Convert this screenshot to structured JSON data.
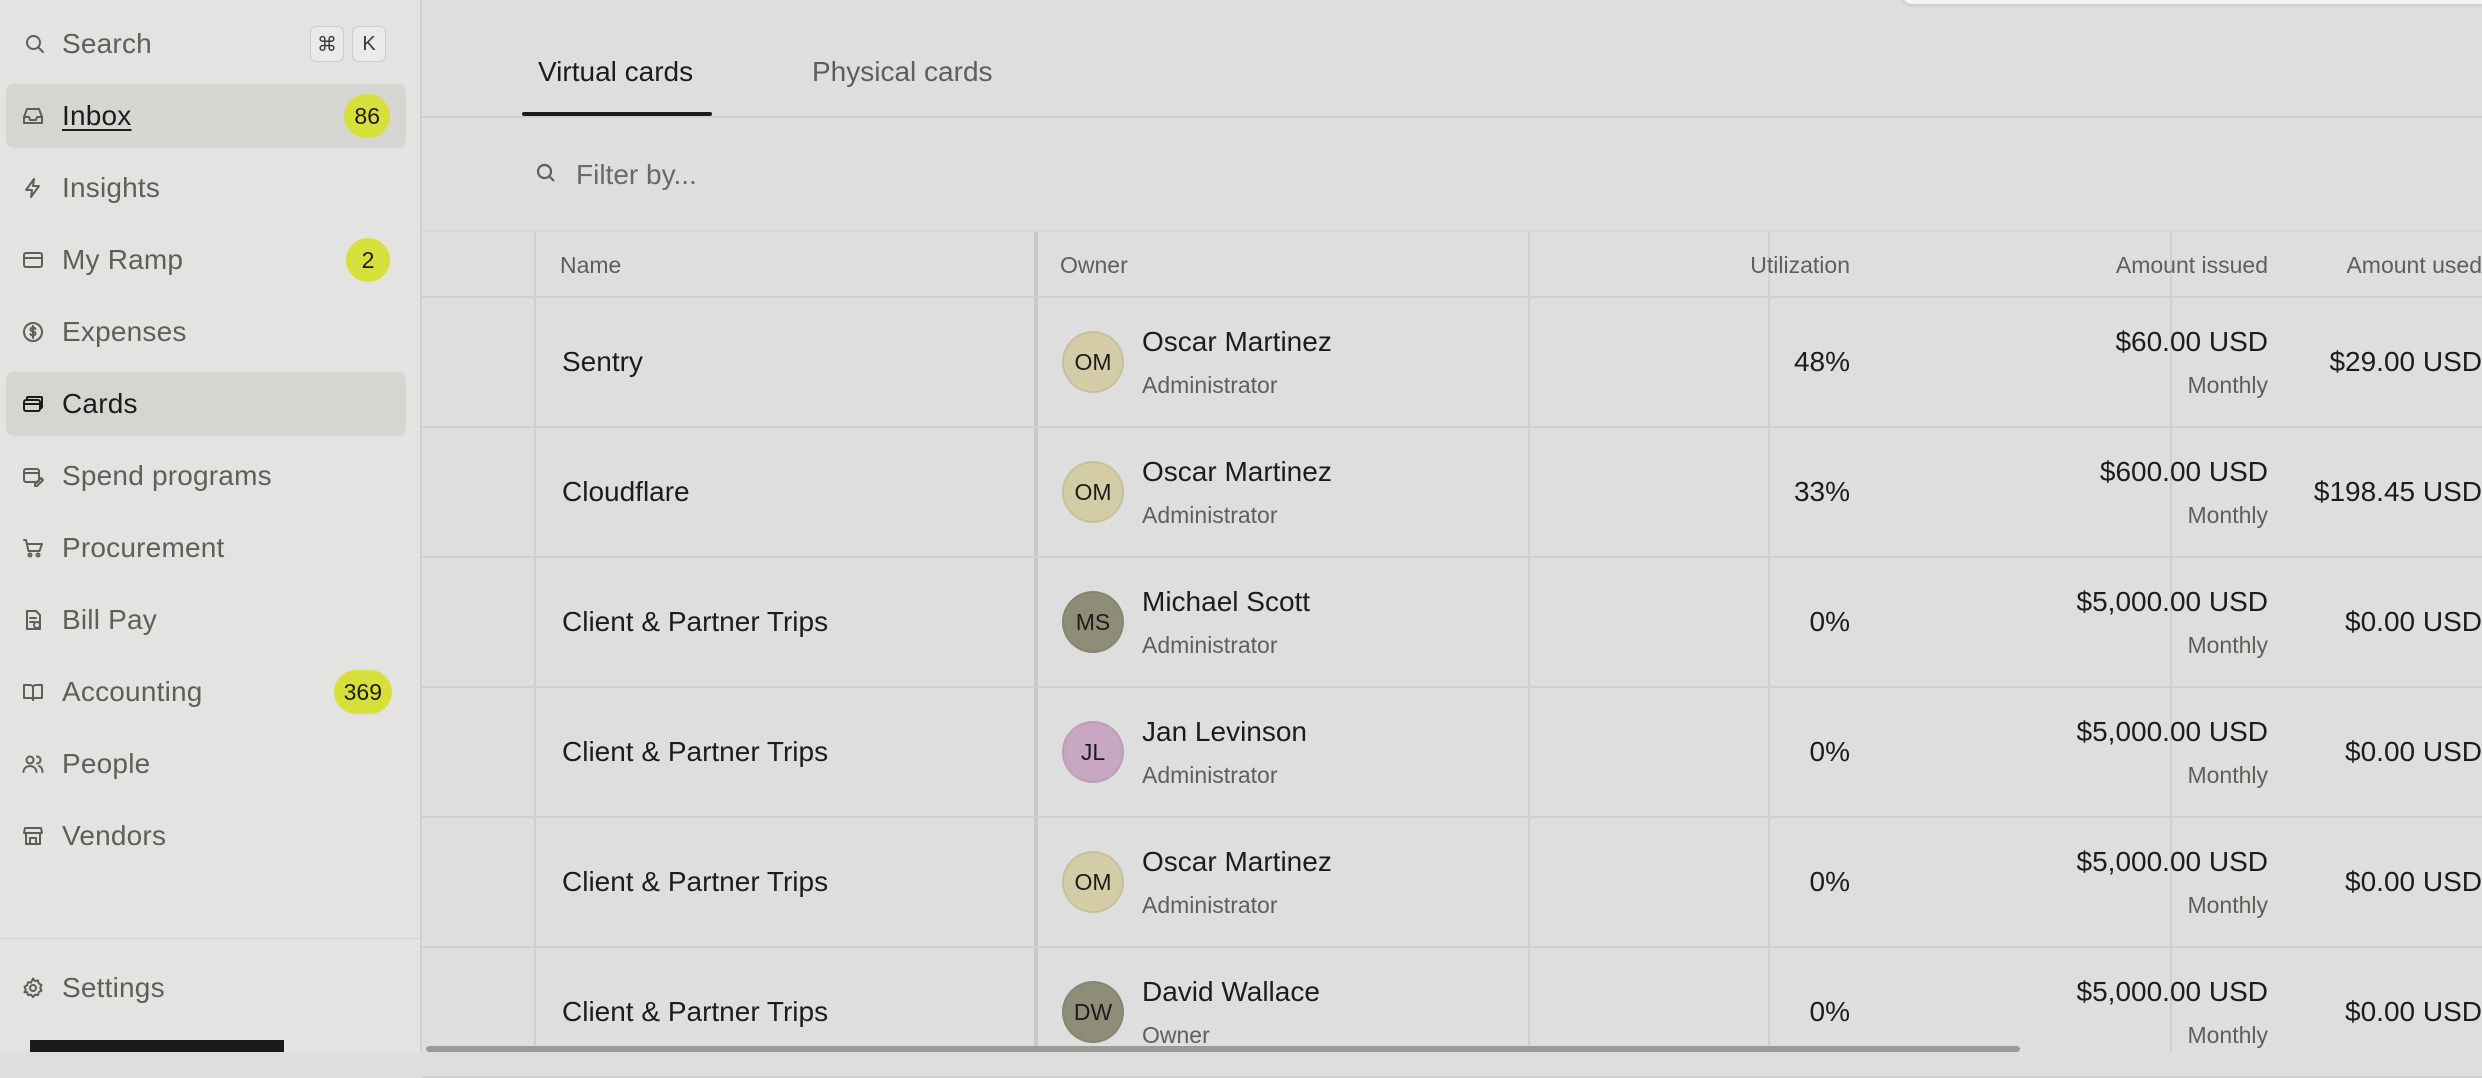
{
  "sidebar": {
    "search": {
      "label": "Search",
      "shortcut_keys": [
        "⌘",
        "K"
      ]
    },
    "items": [
      {
        "label": "Inbox",
        "icon": "inbox-icon",
        "badge": "86"
      },
      {
        "label": "Insights",
        "icon": "bolt-icon",
        "badge": null
      },
      {
        "label": "My Ramp",
        "icon": "card-outline-icon",
        "badge": "2"
      },
      {
        "label": "Expenses",
        "icon": "dollar-circle-icon",
        "badge": null
      },
      {
        "label": "Cards",
        "icon": "cards-stack-icon",
        "badge": null
      },
      {
        "label": "Spend programs",
        "icon": "spend-program-icon",
        "badge": null
      },
      {
        "label": "Procurement",
        "icon": "cart-icon",
        "badge": null
      },
      {
        "label": "Bill Pay",
        "icon": "bill-icon",
        "badge": null
      },
      {
        "label": "Accounting",
        "icon": "book-icon",
        "badge": "369"
      },
      {
        "label": "People",
        "icon": "people-icon",
        "badge": null
      },
      {
        "label": "Vendors",
        "icon": "store-icon",
        "badge": null
      }
    ],
    "settings": {
      "label": "Settings",
      "icon": "gear-icon"
    }
  },
  "tabs": [
    {
      "label": "Virtual cards",
      "active": true
    },
    {
      "label": "Physical cards",
      "active": false
    }
  ],
  "filter": {
    "placeholder": "Filter by..."
  },
  "table": {
    "headers": {
      "name": "Name",
      "owner": "Owner",
      "utilization": "Utilization",
      "amount_issued": "Amount issued",
      "amount_used": "Amount used"
    },
    "rows": [
      {
        "name": "Sentry",
        "initials": "OM",
        "owner": "Oscar Martinez",
        "role": "Administrator",
        "avatar_color": "#d3cca6",
        "utilization": "48%",
        "issued": "$60.00 USD",
        "period": "Monthly",
        "used": "$29.00 USD"
      },
      {
        "name": "Cloudflare",
        "initials": "OM",
        "owner": "Oscar Martinez",
        "role": "Administrator",
        "avatar_color": "#d3cca6",
        "utilization": "33%",
        "issued": "$600.00 USD",
        "period": "Monthly",
        "used": "$198.45 USD"
      },
      {
        "name": "Client & Partner Trips",
        "initials": "MS",
        "owner": "Michael Scott",
        "role": "Administrator",
        "avatar_color": "#8e8e78",
        "utilization": "0%",
        "issued": "$5,000.00 USD",
        "period": "Monthly",
        "used": "$0.00 USD"
      },
      {
        "name": "Client & Partner Trips",
        "initials": "JL",
        "owner": "Jan Levinson",
        "role": "Administrator",
        "avatar_color": "#c8a7c2",
        "utilization": "0%",
        "issued": "$5,000.00 USD",
        "period": "Monthly",
        "used": "$0.00 USD"
      },
      {
        "name": "Client & Partner Trips",
        "initials": "OM",
        "owner": "Oscar Martinez",
        "role": "Administrator",
        "avatar_color": "#d3cca6",
        "utilization": "0%",
        "issued": "$5,000.00 USD",
        "period": "Monthly",
        "used": "$0.00 USD"
      },
      {
        "name": "Client & Partner Trips",
        "initials": "DW",
        "owner": "David Wallace",
        "role": "Owner",
        "avatar_color": "#8e8e78",
        "utilization": "0%",
        "issued": "$5,000.00 USD",
        "period": "Monthly",
        "used": "$0.00 USD"
      }
    ]
  },
  "colors": {
    "badge": "#d7df3a",
    "active_nav": "#d5d5d2",
    "background": "#dedede"
  }
}
